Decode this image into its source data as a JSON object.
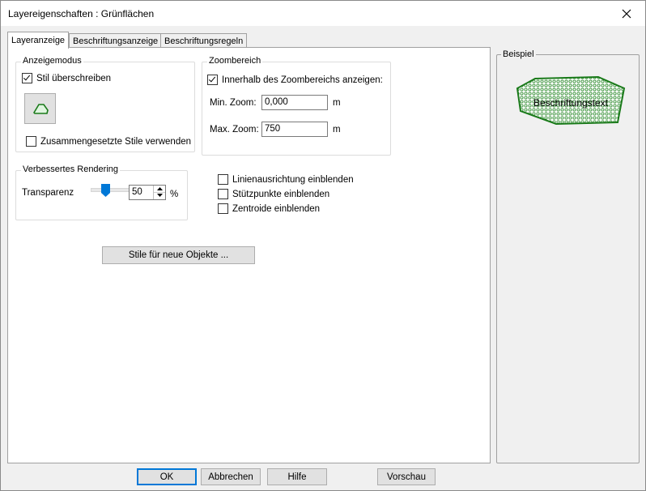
{
  "window": {
    "title": "Layereigenschaften : Grünflächen",
    "close_icon": "close-icon"
  },
  "tabs": [
    {
      "label": "Layeranzeige",
      "active": true
    },
    {
      "label": "Beschriftungsanzeige",
      "active": false
    },
    {
      "label": "Beschriftungsregeln",
      "active": false
    }
  ],
  "display_mode": {
    "group_label": "Anzeigemodus",
    "override_style_label": "Stil überschreiben",
    "override_style_checked": true,
    "style_button_icon": "polygon-style-icon",
    "compound_styles_label": "Zusammengesetzte Stile verwenden",
    "compound_styles_checked": false
  },
  "zoom_range": {
    "group_label": "Zoombereich",
    "within_zoom_label": "Innerhalb des Zoombereichs anzeigen:",
    "within_zoom_checked": true,
    "min_zoom_label": "Min. Zoom:",
    "min_zoom_value": "0,000",
    "min_zoom_unit": "m",
    "max_zoom_label": "Max. Zoom:",
    "max_zoom_value": "750",
    "max_zoom_unit": "m"
  },
  "rendering": {
    "group_label": "Verbessertes Rendering",
    "transparency_label": "Transparenz",
    "transparency_value": "50",
    "transparency_percent": 50,
    "transparency_unit": "%"
  },
  "options": [
    {
      "label": "Linienausrichtung einblenden",
      "checked": false
    },
    {
      "label": "Stützpunkte einblenden",
      "checked": false
    },
    {
      "label": "Zentroide einblenden",
      "checked": false
    }
  ],
  "styles_new_objects_button": "Stile für neue Objekte ...",
  "preview": {
    "group_label": "Beispiel",
    "sample_text": "Beschriftungstext",
    "fill_color": "#2e8b2e",
    "stroke_color": "#1a7a1a"
  },
  "footer": {
    "ok": "OK",
    "cancel": "Abbrechen",
    "help": "Hilfe",
    "preview": "Vorschau"
  }
}
